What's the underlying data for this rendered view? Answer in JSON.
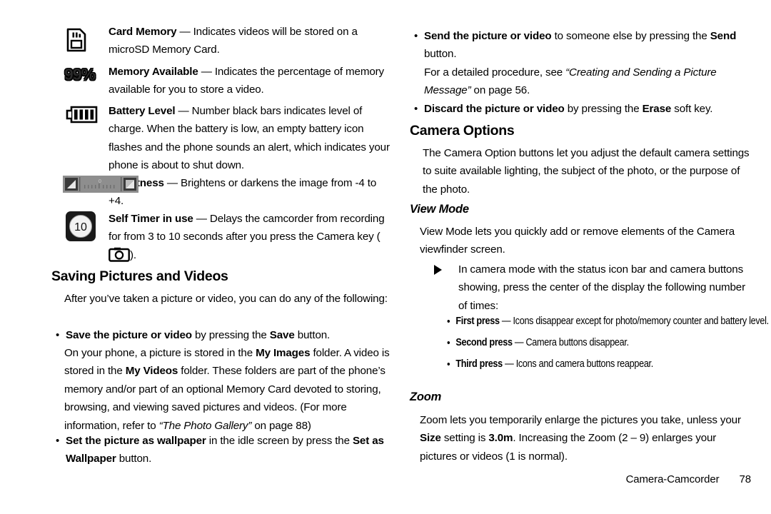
{
  "page": {
    "footer_section": "Camera-Camcorder",
    "footer_page_number": "78"
  },
  "left_column": {
    "icon_items": [
      {
        "icon": "sd-card-icon",
        "term": "Card Memory",
        "dash": " — ",
        "desc": "Indicates videos will be stored on a microSD Memory Card."
      },
      {
        "icon": "memory-available-99-percent-icon",
        "term": "Memory Available",
        "dash": " — ",
        "desc": "Indicates the percentage of memory available for you to store a video."
      },
      {
        "icon": "battery-level-icon",
        "term": "Battery Level",
        "dash": " — ",
        "desc": "Number black bars indicates level of charge. When the battery is low, an empty battery icon flashes and the phone sounds an alert, which indicates your phone is about to shut down."
      },
      {
        "icon": "brightness-slider-icon",
        "term": "Brightness",
        "dash": " — ",
        "desc": "Brightens or darkens the image from -4 to +4."
      },
      {
        "icon": "self-timer-10-icon",
        "term": "Self Timer in use",
        "dash": " — ",
        "desc_before": "Delays the camcorder from recording for from 3 to 10 seconds after you press the Camera key (",
        "desc_after": ")."
      }
    ],
    "heading": "Saving Pictures and Videos",
    "intro": "After you’ve taken a picture or video, you can do any of the following:",
    "bullets": [
      {
        "bold_lead": "Save the picture or video",
        "rest_1": " by pressing the ",
        "bold_mid": "Save",
        "rest_2": " button."
      },
      {
        "bold_lead": "Set the picture as wallpaper",
        "rest_1": " in the idle screen by press the ",
        "bold_mid": "Set as Wallpaper",
        "rest_2": " button."
      }
    ],
    "save_detail": {
      "t1": "On your phone, a picture is stored in the ",
      "b1": "My Images",
      "t2": " folder. A video is stored in the ",
      "b2": "My Videos",
      "t3": " folder. These folders are part of the phone’s memory and/or part of an optional Memory Card devoted to storing, browsing, and viewing saved pictures and videos. (For more information, refer to ",
      "i1": "“The Photo Gallery”",
      "t4": " on page 88)"
    }
  },
  "right_column": {
    "bullets_top": [
      {
        "bold_lead": "Send the picture or video",
        "rest_1": " to someone else by pressing the ",
        "bold_mid": "Send",
        "rest_2": " button."
      },
      {
        "bold_lead": "Discard the picture or video",
        "rest_1": " by pressing the ",
        "bold_mid": "Erase",
        "rest_2": " soft key."
      }
    ],
    "send_detail": {
      "t1": "For a detailed procedure, see ",
      "i1": "“Creating and Sending a Picture Message”",
      "t2": " on page 56."
    },
    "camera_options_heading": "Camera Options",
    "camera_options_body": "The Camera Option buttons let you adjust the default camera settings to suite available lighting, the subject of the photo, or the purpose of the photo.",
    "view_mode_heading": "View Mode",
    "view_mode_body": "View Mode lets you quickly add or remove elements of the Camera viewfinder screen.",
    "view_mode_step": "In camera mode with the status icon bar and camera buttons showing, press the center of the display the following number of times:",
    "press_list": [
      {
        "bold_lead": "First press",
        "dash": " — ",
        "rest": "Icons disappear except for photo/memory counter and battery level."
      },
      {
        "bold_lead": "Second press",
        "dash": " — ",
        "rest": "Camera buttons disappear."
      },
      {
        "bold_lead": "Third press",
        "dash": " — ",
        "rest": "Icons and camera buttons reappear."
      }
    ],
    "zoom_heading": "Zoom",
    "zoom_body": {
      "t1": "Zoom lets you temporarily enlarge the pictures you take, unless your ",
      "b1": "Size",
      "t2": " setting is ",
      "b2": "3.0m",
      "t3": ". Increasing the Zoom (2 – 9) enlarges your pictures or videos (1 is normal)."
    }
  },
  "colors": {
    "text": "#000000",
    "background": "#ffffff",
    "icon_gray": "#8a8a8a",
    "icon_dark": "#1a1a1a"
  }
}
